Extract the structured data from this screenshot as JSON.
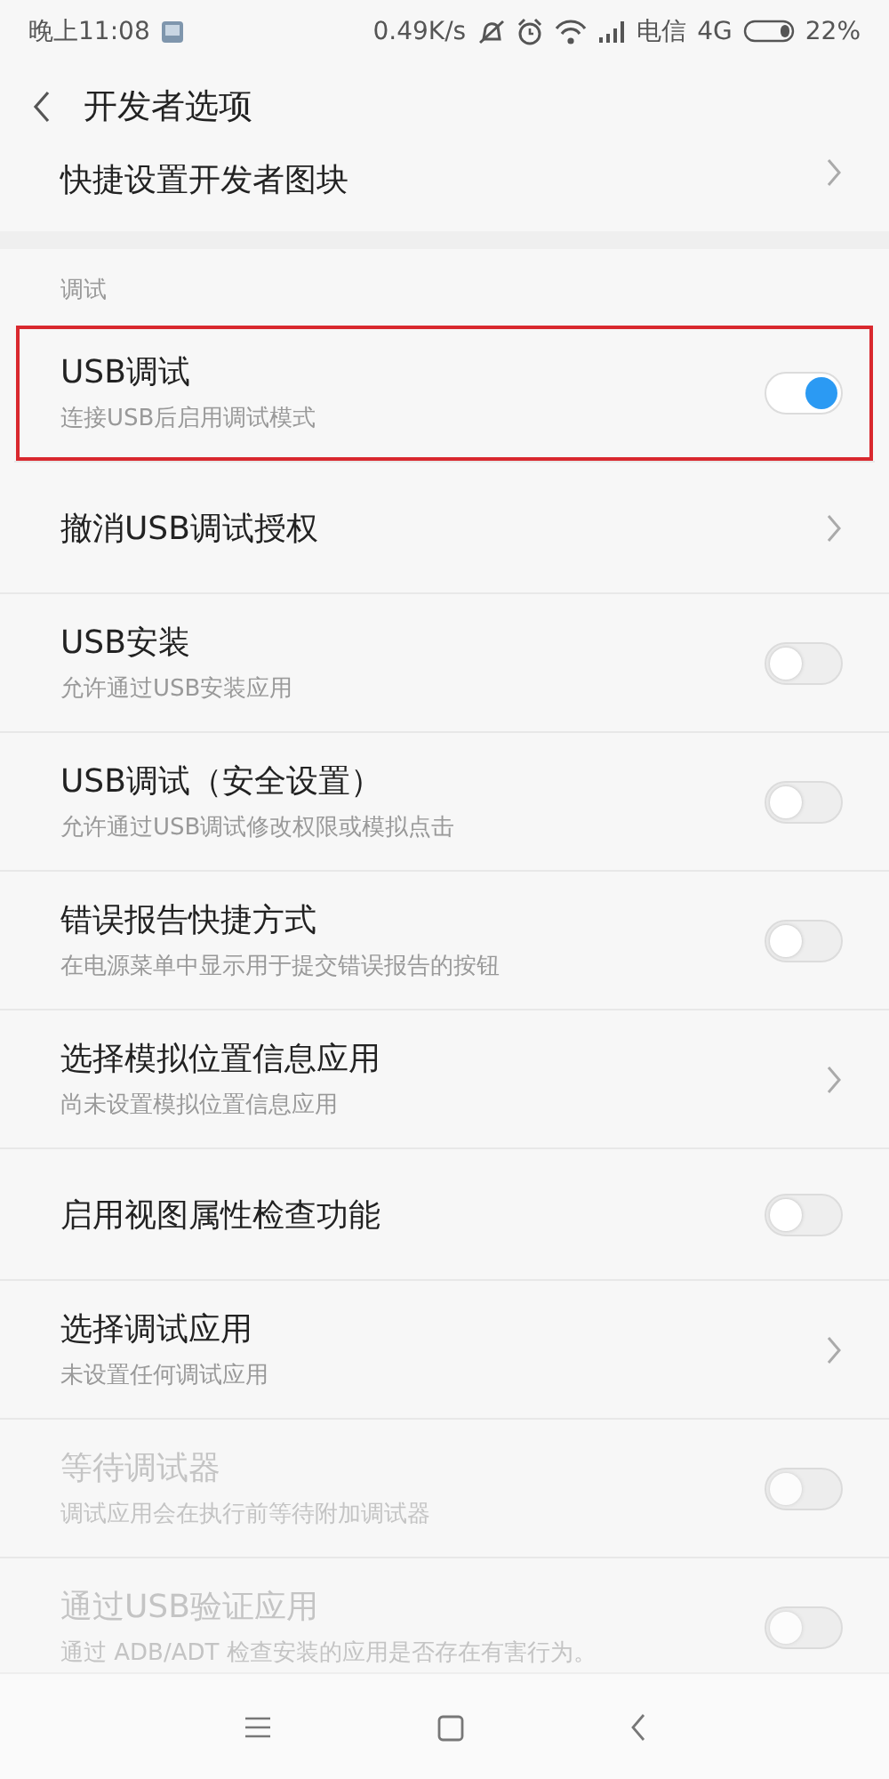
{
  "status_bar": {
    "time": "晚上11:08",
    "speed": "0.49K/s",
    "carrier": "电信",
    "network": "4G",
    "battery": "22%"
  },
  "header": {
    "title": "开发者选项"
  },
  "top_item": {
    "kind": "link",
    "title": "快捷设置开发者图块",
    "disabled": false,
    "highlighted": false
  },
  "section": {
    "label": "调试"
  },
  "items": [
    {
      "kind": "toggle",
      "title": "USB调试",
      "subtitle": "连接USB后启用调试模式",
      "on": true,
      "disabled": false,
      "highlighted": true
    },
    {
      "kind": "link",
      "title": "撤消USB调试授权",
      "disabled": false,
      "highlighted": false
    },
    {
      "kind": "toggle",
      "title": "USB安装",
      "subtitle": "允许通过USB安装应用",
      "on": false,
      "disabled": false,
      "highlighted": false
    },
    {
      "kind": "toggle",
      "title": "USB调试（安全设置）",
      "subtitle": "允许通过USB调试修改权限或模拟点击",
      "on": false,
      "disabled": false,
      "highlighted": false
    },
    {
      "kind": "toggle",
      "title": "错误报告快捷方式",
      "subtitle": "在电源菜单中显示用于提交错误报告的按钮",
      "on": false,
      "disabled": false,
      "highlighted": false
    },
    {
      "kind": "link",
      "title": "选择模拟位置信息应用",
      "subtitle": "尚未设置模拟位置信息应用",
      "disabled": false,
      "highlighted": false
    },
    {
      "kind": "toggle",
      "title": "启用视图属性检查功能",
      "on": false,
      "disabled": false,
      "highlighted": false
    },
    {
      "kind": "link",
      "title": "选择调试应用",
      "subtitle": "未设置任何调试应用",
      "disabled": false,
      "highlighted": false
    },
    {
      "kind": "toggle",
      "title": "等待调试器",
      "subtitle": "调试应用会在执行前等待附加调试器",
      "on": false,
      "disabled": true,
      "highlighted": false
    },
    {
      "kind": "toggle",
      "title": "通过USB验证应用",
      "subtitle": "通过 ADB/ADT 检查安装的应用是否存在有害行为。",
      "on": false,
      "disabled": true,
      "highlighted": false
    }
  ]
}
